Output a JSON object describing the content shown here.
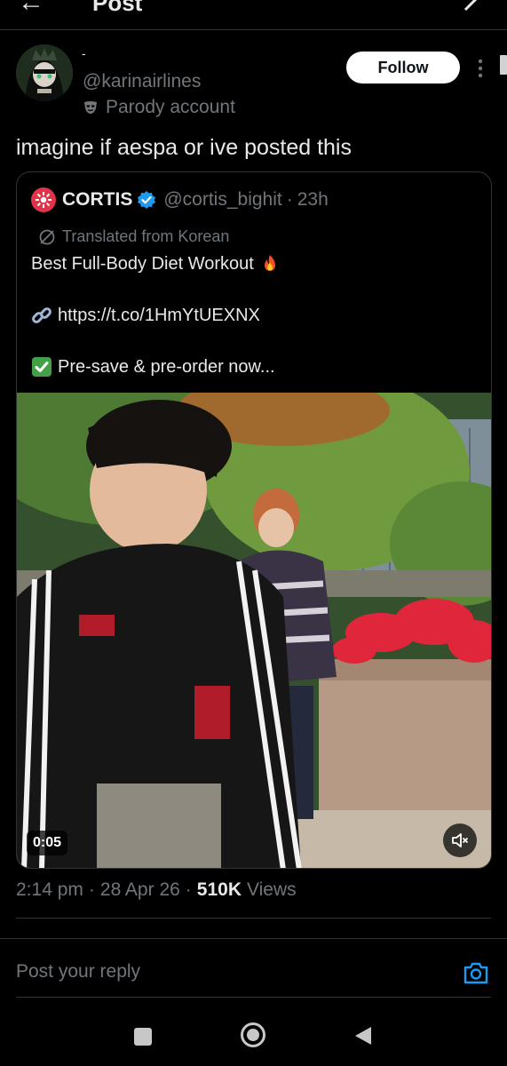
{
  "topbar": {
    "back_icon": "arrow-left-icon",
    "title": "Post",
    "refresh_icon": "grok-icon"
  },
  "author": {
    "display_name": "-",
    "handle": "@karinairlines",
    "parody_label": "Parody account",
    "parody_icon": "mask-icon",
    "follow_label": "Follow",
    "more_icon": "more-vertical-icon"
  },
  "tweet": {
    "text": "imagine if aespa or ive posted this"
  },
  "quote": {
    "name": "CORTIS",
    "handle": "@cortis_bighit",
    "dot": "·",
    "time": "23h",
    "translated_label": "Translated from Korean",
    "line1": "Best Full-Body Diet Workout",
    "line2": "https://t.co/1HmYtUEXNX",
    "line3": "Pre-save & pre-order now...",
    "video_time": "0:05"
  },
  "meta": {
    "time": "2:14 pm",
    "dot1": "·",
    "date": "28 Apr 26",
    "dot2": "·",
    "views_count": "510K",
    "views_label": "Views"
  },
  "reply": {
    "placeholder": "Post your reply"
  },
  "colors": {
    "background": "#000000",
    "text": "#e7e9ea",
    "muted": "#71767b",
    "accent": "#1d9bf0",
    "border": "#2f3336",
    "cortis_red": "#e0344a"
  }
}
